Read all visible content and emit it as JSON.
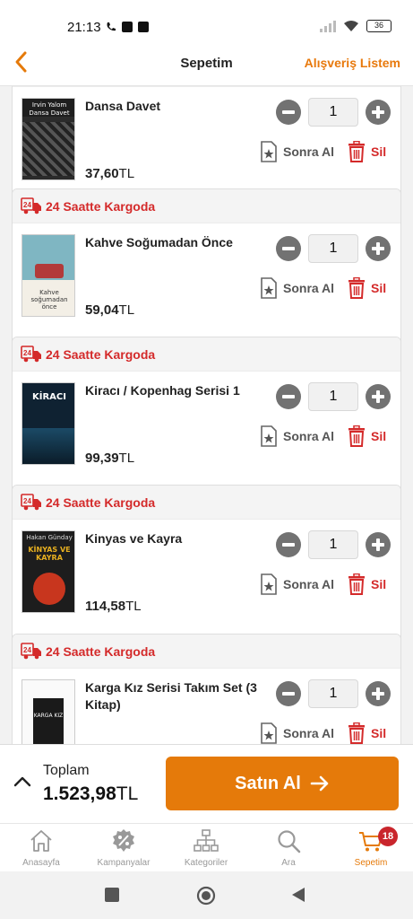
{
  "status_bar": {
    "time": "21:13",
    "battery": "36"
  },
  "header": {
    "title": "Sepetim",
    "list_link": "Alışveriş Listem"
  },
  "cart": {
    "items": [
      {
        "shipping": "",
        "title": "Dansa Davet",
        "price": "37,60",
        "currency": "TL",
        "quantity": "1",
        "later_label": "Sonra Al",
        "delete_label": "Sil"
      },
      {
        "shipping": "24 Saatte Kargoda",
        "title": "Kahve Soğumadan Önce",
        "price": "59,04",
        "currency": "TL",
        "quantity": "1",
        "later_label": "Sonra Al",
        "delete_label": "Sil"
      },
      {
        "shipping": "24 Saatte Kargoda",
        "title": "Kiracı / Kopenhag Serisi 1",
        "price": "99,39",
        "currency": "TL",
        "quantity": "1",
        "later_label": "Sonra Al",
        "delete_label": "Sil"
      },
      {
        "shipping": "24 Saatte Kargoda",
        "title": "Kinyas ve Kayra",
        "price": "114,58",
        "currency": "TL",
        "quantity": "1",
        "later_label": "Sonra Al",
        "delete_label": "Sil"
      },
      {
        "shipping": "24 Saatte Kargoda",
        "title": "Karga Kız Serisi Takım Set (3 Kitap)",
        "price": "",
        "currency": "",
        "quantity": "1",
        "later_label": "Sonra Al",
        "delete_label": "Sil"
      }
    ],
    "covers": [
      {
        "text_top": "Irvin Yalom",
        "text_mid": "Dansa Davet"
      },
      {
        "text_top": "",
        "text_mid": "Kahve soğumadan önce"
      },
      {
        "text_top": "",
        "text_mid": "KİRACI"
      },
      {
        "text_top": "Hakan Günday",
        "text_mid": "KİNYAS VE KAYRA"
      },
      {
        "text_top": "",
        "text_mid": "KARGA KIZ"
      }
    ]
  },
  "checkout": {
    "total_label": "Toplam",
    "total_value": "1.523,98",
    "currency": "TL",
    "buy_label": "Satın Al"
  },
  "tabs": [
    {
      "label": "Anasayfa",
      "icon": "home-icon"
    },
    {
      "label": "Kampanyalar",
      "icon": "percent-badge-icon"
    },
    {
      "label": "Kategoriler",
      "icon": "hierarchy-icon"
    },
    {
      "label": "Ara",
      "icon": "search-icon"
    },
    {
      "label": "Sepetim",
      "icon": "cart-icon",
      "badge": "18",
      "active": true
    }
  ],
  "colors": {
    "accent": "#e57a0a",
    "shipping_red": "#d42a2a",
    "badge_red": "#c9252c"
  }
}
